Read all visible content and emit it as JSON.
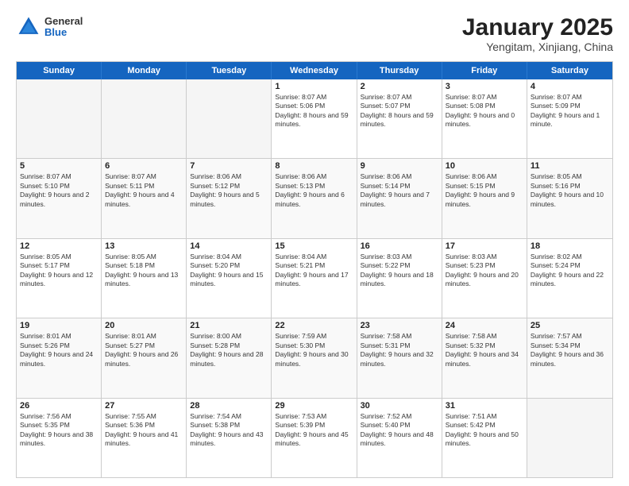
{
  "header": {
    "logo": {
      "general": "General",
      "blue": "Blue"
    },
    "title": "January 2025",
    "subtitle": "Yengitam, Xinjiang, China"
  },
  "days_of_week": [
    "Sunday",
    "Monday",
    "Tuesday",
    "Wednesday",
    "Thursday",
    "Friday",
    "Saturday"
  ],
  "weeks": [
    [
      {
        "day": "",
        "info": "",
        "empty": true
      },
      {
        "day": "",
        "info": "",
        "empty": true
      },
      {
        "day": "",
        "info": "",
        "empty": true
      },
      {
        "day": "1",
        "info": "Sunrise: 8:07 AM\nSunset: 5:06 PM\nDaylight: 8 hours and 59 minutes."
      },
      {
        "day": "2",
        "info": "Sunrise: 8:07 AM\nSunset: 5:07 PM\nDaylight: 8 hours and 59 minutes."
      },
      {
        "day": "3",
        "info": "Sunrise: 8:07 AM\nSunset: 5:08 PM\nDaylight: 9 hours and 0 minutes."
      },
      {
        "day": "4",
        "info": "Sunrise: 8:07 AM\nSunset: 5:09 PM\nDaylight: 9 hours and 1 minute."
      }
    ],
    [
      {
        "day": "5",
        "info": "Sunrise: 8:07 AM\nSunset: 5:10 PM\nDaylight: 9 hours and 2 minutes.",
        "alt": true
      },
      {
        "day": "6",
        "info": "Sunrise: 8:07 AM\nSunset: 5:11 PM\nDaylight: 9 hours and 4 minutes.",
        "alt": true
      },
      {
        "day": "7",
        "info": "Sunrise: 8:06 AM\nSunset: 5:12 PM\nDaylight: 9 hours and 5 minutes.",
        "alt": true
      },
      {
        "day": "8",
        "info": "Sunrise: 8:06 AM\nSunset: 5:13 PM\nDaylight: 9 hours and 6 minutes.",
        "alt": true
      },
      {
        "day": "9",
        "info": "Sunrise: 8:06 AM\nSunset: 5:14 PM\nDaylight: 9 hours and 7 minutes.",
        "alt": true
      },
      {
        "day": "10",
        "info": "Sunrise: 8:06 AM\nSunset: 5:15 PM\nDaylight: 9 hours and 9 minutes.",
        "alt": true
      },
      {
        "day": "11",
        "info": "Sunrise: 8:05 AM\nSunset: 5:16 PM\nDaylight: 9 hours and 10 minutes.",
        "alt": true
      }
    ],
    [
      {
        "day": "12",
        "info": "Sunrise: 8:05 AM\nSunset: 5:17 PM\nDaylight: 9 hours and 12 minutes."
      },
      {
        "day": "13",
        "info": "Sunrise: 8:05 AM\nSunset: 5:18 PM\nDaylight: 9 hours and 13 minutes."
      },
      {
        "day": "14",
        "info": "Sunrise: 8:04 AM\nSunset: 5:20 PM\nDaylight: 9 hours and 15 minutes."
      },
      {
        "day": "15",
        "info": "Sunrise: 8:04 AM\nSunset: 5:21 PM\nDaylight: 9 hours and 17 minutes."
      },
      {
        "day": "16",
        "info": "Sunrise: 8:03 AM\nSunset: 5:22 PM\nDaylight: 9 hours and 18 minutes."
      },
      {
        "day": "17",
        "info": "Sunrise: 8:03 AM\nSunset: 5:23 PM\nDaylight: 9 hours and 20 minutes."
      },
      {
        "day": "18",
        "info": "Sunrise: 8:02 AM\nSunset: 5:24 PM\nDaylight: 9 hours and 22 minutes."
      }
    ],
    [
      {
        "day": "19",
        "info": "Sunrise: 8:01 AM\nSunset: 5:26 PM\nDaylight: 9 hours and 24 minutes.",
        "alt": true
      },
      {
        "day": "20",
        "info": "Sunrise: 8:01 AM\nSunset: 5:27 PM\nDaylight: 9 hours and 26 minutes.",
        "alt": true
      },
      {
        "day": "21",
        "info": "Sunrise: 8:00 AM\nSunset: 5:28 PM\nDaylight: 9 hours and 28 minutes.",
        "alt": true
      },
      {
        "day": "22",
        "info": "Sunrise: 7:59 AM\nSunset: 5:30 PM\nDaylight: 9 hours and 30 minutes.",
        "alt": true
      },
      {
        "day": "23",
        "info": "Sunrise: 7:58 AM\nSunset: 5:31 PM\nDaylight: 9 hours and 32 minutes.",
        "alt": true
      },
      {
        "day": "24",
        "info": "Sunrise: 7:58 AM\nSunset: 5:32 PM\nDaylight: 9 hours and 34 minutes.",
        "alt": true
      },
      {
        "day": "25",
        "info": "Sunrise: 7:57 AM\nSunset: 5:34 PM\nDaylight: 9 hours and 36 minutes.",
        "alt": true
      }
    ],
    [
      {
        "day": "26",
        "info": "Sunrise: 7:56 AM\nSunset: 5:35 PM\nDaylight: 9 hours and 38 minutes."
      },
      {
        "day": "27",
        "info": "Sunrise: 7:55 AM\nSunset: 5:36 PM\nDaylight: 9 hours and 41 minutes."
      },
      {
        "day": "28",
        "info": "Sunrise: 7:54 AM\nSunset: 5:38 PM\nDaylight: 9 hours and 43 minutes."
      },
      {
        "day": "29",
        "info": "Sunrise: 7:53 AM\nSunset: 5:39 PM\nDaylight: 9 hours and 45 minutes."
      },
      {
        "day": "30",
        "info": "Sunrise: 7:52 AM\nSunset: 5:40 PM\nDaylight: 9 hours and 48 minutes."
      },
      {
        "day": "31",
        "info": "Sunrise: 7:51 AM\nSunset: 5:42 PM\nDaylight: 9 hours and 50 minutes."
      },
      {
        "day": "",
        "info": "",
        "empty": true
      }
    ]
  ]
}
